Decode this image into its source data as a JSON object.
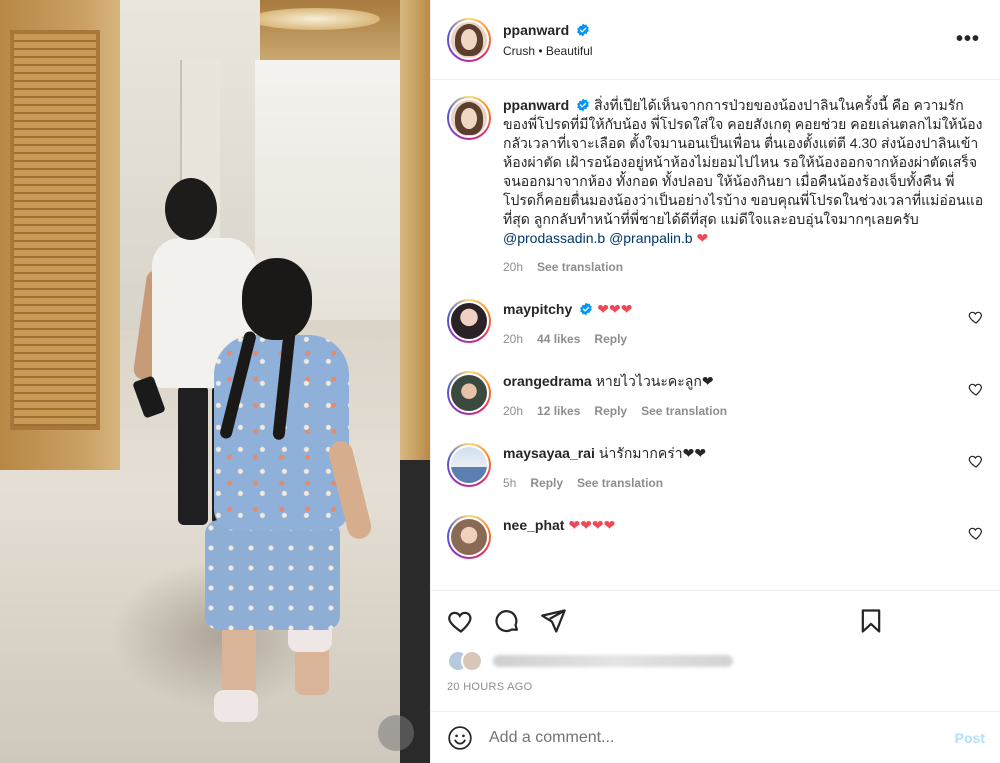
{
  "post": {
    "username": "ppanward",
    "subtitle": "Crush • Beautiful",
    "more_label": "•••"
  },
  "caption": {
    "username": "ppanward",
    "text": "สิ่งที่เปียได้เห็นจากการป่วยของน้องปาลินในครั้งนี้ คือ ความรักของพี่โปรดที่มีให้กับน้อง พี่โปรดใส่ใจ คอยสังเกตุ คอยช่วย คอยเล่นตลกไม่ให้น้องกลัวเวลาที่เจาะเลือด ตั้งใจมานอนเป็นเพื่อน ตื่นเองตั้งแต่ตี 4.30 ส่งน้องปาลินเข้าห้องผ่าตัด เฝ้ารอน้องอยู่หน้าห้องไม่ยอมไปไหน รอให้น้องออกจากห้องผ่าตัดเสร็จจนออกมาจากห้อง ทั้งกอด ทั้งปลอบ ให้น้องกินยา เมื่อคืนน้องร้องเจ็บทั้งคืน พี่โปรดก็คอยตื่นมองน้องว่าเป็นอย่างไรบ้าง ขอบคุณพี่โปรดในช่วงเวลาที่แม่อ่อนแอที่สุด ลูกกลับทำหน้าที่พี่ชายได้ดีที่สุด แม่ดีใจและอบอุ่นใจมากๆเลยครับ",
    "mention1": "@prodassadin.b",
    "mention2": "@pranpalin.b",
    "heart": "❤",
    "time": "20h",
    "see_translation": "See translation"
  },
  "comments": [
    {
      "username": "maypitchy",
      "verified": true,
      "text": "❤❤❤",
      "time": "20h",
      "likes": "44 likes",
      "reply": "Reply",
      "translation": ""
    },
    {
      "username": "orangedrama",
      "verified": false,
      "text": "หายไวไวนะคะลูก❤",
      "time": "20h",
      "likes": "12 likes",
      "reply": "Reply",
      "translation": "See translation"
    },
    {
      "username": "maysayaa_rai",
      "verified": false,
      "text": "น่ารักมากคร่า❤❤",
      "time": "5h",
      "likes": "",
      "reply": "Reply",
      "translation": "See translation"
    },
    {
      "username": "nee_phat",
      "verified": false,
      "text": "❤❤❤❤",
      "time": "",
      "likes": "",
      "reply": "",
      "translation": ""
    }
  ],
  "footer": {
    "time_ago": "20 HOURS AGO",
    "comment_placeholder": "Add a comment...",
    "post_label": "Post"
  },
  "colors": {
    "link": "#00376b",
    "verified": "#0095f6",
    "heart": "#ed4956",
    "muted": "#8e8e8e",
    "post_disabled": "#b2dffc"
  }
}
